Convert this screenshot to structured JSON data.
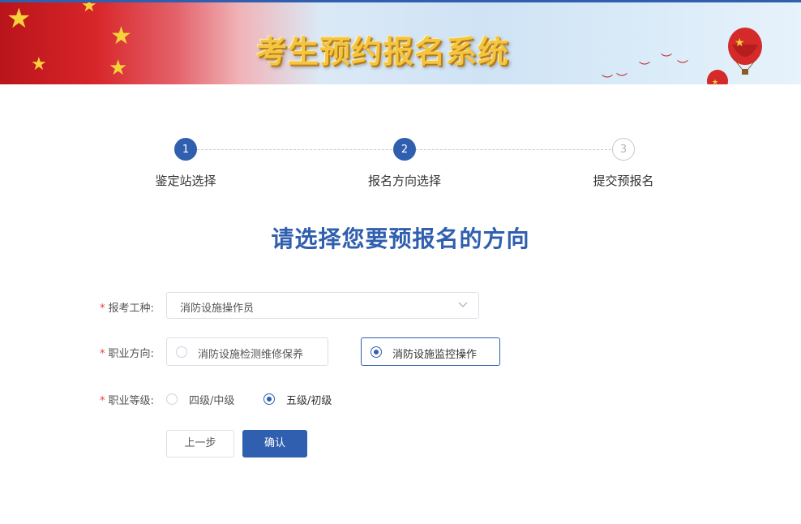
{
  "banner": {
    "title": "考生预约报名系统"
  },
  "steps": [
    {
      "number": "1",
      "label": "鉴定站选择",
      "state": "done"
    },
    {
      "number": "2",
      "label": "报名方向选择",
      "state": "done"
    },
    {
      "number": "3",
      "label": "提交预报名",
      "state": "todo"
    }
  ],
  "page_title": "请选择您要预报名的方向",
  "form": {
    "required_mark": "*",
    "trade": {
      "label": "报考工种:",
      "value": "消防设施操作员"
    },
    "direction": {
      "label": "职业方向:",
      "options": [
        {
          "label": "消防设施检测维修保养",
          "selected": false
        },
        {
          "label": "消防设施监控操作",
          "selected": true
        }
      ]
    },
    "level": {
      "label": "职业等级:",
      "options": [
        {
          "label": "四级/中级",
          "selected": false
        },
        {
          "label": "五级/初级",
          "selected": true
        }
      ]
    }
  },
  "buttons": {
    "prev": "上一步",
    "confirm": "确认"
  },
  "colors": {
    "primary": "#2f5fae",
    "required": "#e0453b",
    "banner_title": "#f4c542"
  }
}
